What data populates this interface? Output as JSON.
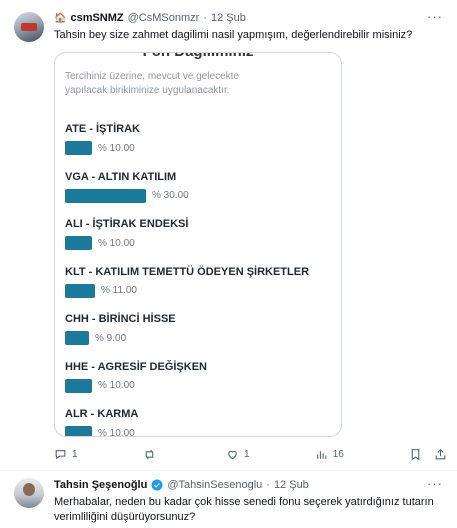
{
  "tweet1": {
    "display_name": "csmSNMZ",
    "name_prefix": "🏠",
    "handle": "@CsMSonmzr",
    "dot": "·",
    "date": "12 Şub",
    "text": "Tahsin bey size zahmet dagilimi nasil yapmışım, değerlendirebilir misiniz?"
  },
  "card": {
    "title": "Fon Dağılımınız",
    "subtitle": "Tercihiniz üzerine, mevcut ve gelecekte yapılacak birikiminize uygulanacaktır.",
    "funds": [
      {
        "name": "ATE - İŞTİRAK",
        "value": "% 10.00",
        "percent": 10
      },
      {
        "name": "VGA - ALTIN KATILIM",
        "value": "% 30.00",
        "percent": 30
      },
      {
        "name": "ALI - İŞTİRAK ENDEKSİ",
        "value": "% 10.00",
        "percent": 10
      },
      {
        "name": "KLT - KATILIM TEMETTÜ ÖDEYEN ŞİRKETLER",
        "value": "% 11.00",
        "percent": 11
      },
      {
        "name": "CHH - BİRİNCİ HİSSE",
        "value": "% 9.00",
        "percent": 9
      },
      {
        "name": "HHE - AGRESİF DEĞİŞKEN",
        "value": "% 10.00",
        "percent": 10
      },
      {
        "name": "ALR - KARMA",
        "value": "% 10.00",
        "percent": 10
      }
    ]
  },
  "actions": {
    "reply_count": "1",
    "retweet_count": "",
    "like_count": "1",
    "views_count": "16",
    "icons": [
      "reply-icon",
      "retweet-icon",
      "like-icon",
      "views-icon",
      "bookmark-icon",
      "share-icon"
    ]
  },
  "tweet2": {
    "display_name": "Tahsin Şeşenoğlu",
    "handle": "@TahsinSesenoglu",
    "dot": "·",
    "date": "12 Şub",
    "text": "Merhabalar, neden bu kadar çok hisse senedi fonu seçerek yatırdığınız tutarın verimliliğini düşürüyorsunuz?"
  },
  "colors": {
    "bar": "#1a7a9c",
    "verified": "#1d9bf0",
    "muted": "#536471"
  }
}
